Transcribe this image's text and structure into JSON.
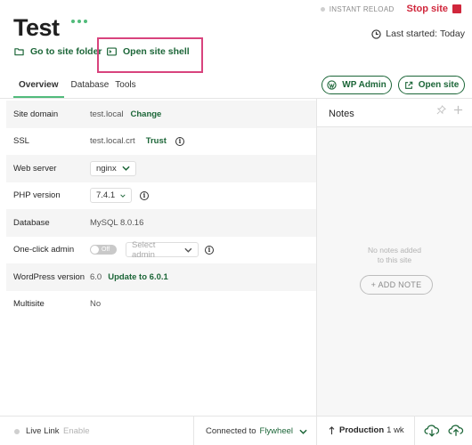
{
  "header": {
    "site_title": "Test",
    "instant_reload_label": "INSTANT RELOAD",
    "stop_site_label": "Stop site",
    "last_started_label": "Last started:",
    "last_started_value": "Today",
    "go_to_site_folder": "Go to site folder",
    "open_site_shell": "Open site shell"
  },
  "tabs": [
    {
      "label": "Overview",
      "active": true
    },
    {
      "label": "Database",
      "active": false
    },
    {
      "label": "Tools",
      "active": false
    }
  ],
  "buttons": {
    "wp_admin": "WP Admin",
    "open_site": "Open site"
  },
  "overview": {
    "site_domain": {
      "label": "Site domain",
      "value": "test.local",
      "action": "Change"
    },
    "ssl": {
      "label": "SSL",
      "value": "test.local.crt",
      "action": "Trust"
    },
    "web_server": {
      "label": "Web server",
      "value": "nginx"
    },
    "php_version": {
      "label": "PHP version",
      "value": "7.4.1"
    },
    "database": {
      "label": "Database",
      "value": "MySQL 8.0.16"
    },
    "one_click_admin": {
      "label": "One-click admin",
      "toggle_label": "Off",
      "select_placeholder": "Select admin"
    },
    "wordpress_version": {
      "label": "WordPress version",
      "value": "6.0",
      "action": "Update to 6.0.1"
    },
    "multisite": {
      "label": "Multisite",
      "value": "No"
    }
  },
  "notes": {
    "title": "Notes",
    "empty_line1": "No notes added",
    "empty_line2": "to this site",
    "add_note": "+ ADD NOTE"
  },
  "footer": {
    "live_link_label": "Live Link",
    "live_link_action": "Enable",
    "connected_to": "Connected to",
    "provider": "Flywheel",
    "environment": "Production",
    "environment_age": "1 wk"
  },
  "colors": {
    "accent_green": "#51bb7b",
    "link_green": "#1c6638",
    "stop_red": "#d0273c",
    "highlight_pink": "#d8437d"
  }
}
